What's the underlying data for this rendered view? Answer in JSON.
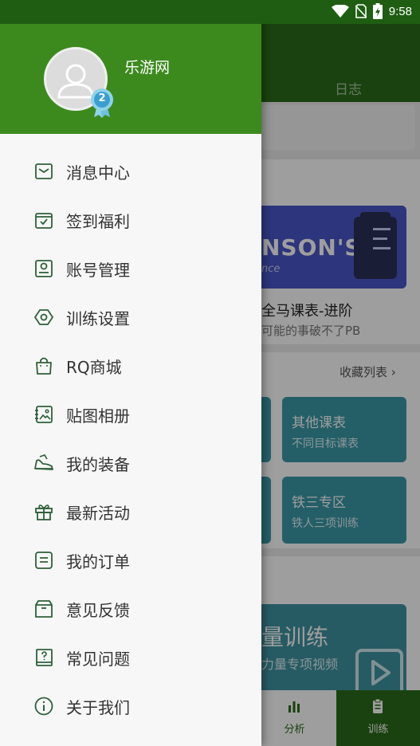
{
  "status_bar": {
    "time": "9:58",
    "icons": [
      "wifi-icon",
      "no-sim-icon",
      "battery-charging-icon"
    ]
  },
  "background_app": {
    "header_tab": "日志",
    "banner_text": "NSON'S",
    "banner_subtext": "nce",
    "plan_title": "全马课表-进阶",
    "plan_subtitle": "可能的事破不了PB",
    "favorites_link": "收藏列表 ›",
    "tiles": [
      {
        "title": "其他课表",
        "subtitle": "不同目标课表"
      },
      {
        "title": "铁三专区",
        "subtitle": "铁人三项训练"
      }
    ],
    "video_title": "量训练",
    "video_subtitle": "力量专项视频",
    "bottom_nav": [
      {
        "label": "分析",
        "icon": "bar-chart-icon"
      },
      {
        "label": "训练",
        "icon": "clipboard-icon"
      }
    ]
  },
  "drawer": {
    "username": "乐游网",
    "level_badge": "2",
    "menu": [
      {
        "label": "消息中心",
        "icon": "envelope-icon"
      },
      {
        "label": "签到福利",
        "icon": "calendar-check-icon"
      },
      {
        "label": "账号管理",
        "icon": "id-card-icon"
      },
      {
        "label": "训练设置",
        "icon": "hexagon-settings-icon"
      },
      {
        "label": "RQ商城",
        "icon": "shopping-bag-icon"
      },
      {
        "label": "贴图相册",
        "icon": "photo-album-icon"
      },
      {
        "label": "我的装备",
        "icon": "shoe-icon"
      },
      {
        "label": "最新活动",
        "icon": "gift-icon"
      },
      {
        "label": "我的订单",
        "icon": "order-list-icon"
      },
      {
        "label": "意见反馈",
        "icon": "feedback-box-icon"
      },
      {
        "label": "常见问题",
        "icon": "faq-book-icon"
      },
      {
        "label": "关于我们",
        "icon": "info-icon"
      }
    ]
  },
  "colors": {
    "drawer_header": "#3c8a1e",
    "app_green": "#2a6b1a",
    "status_bar": "#1f5e12",
    "tile_teal": "#3b9aa8",
    "icon_stroke": "#2f5f3a"
  }
}
